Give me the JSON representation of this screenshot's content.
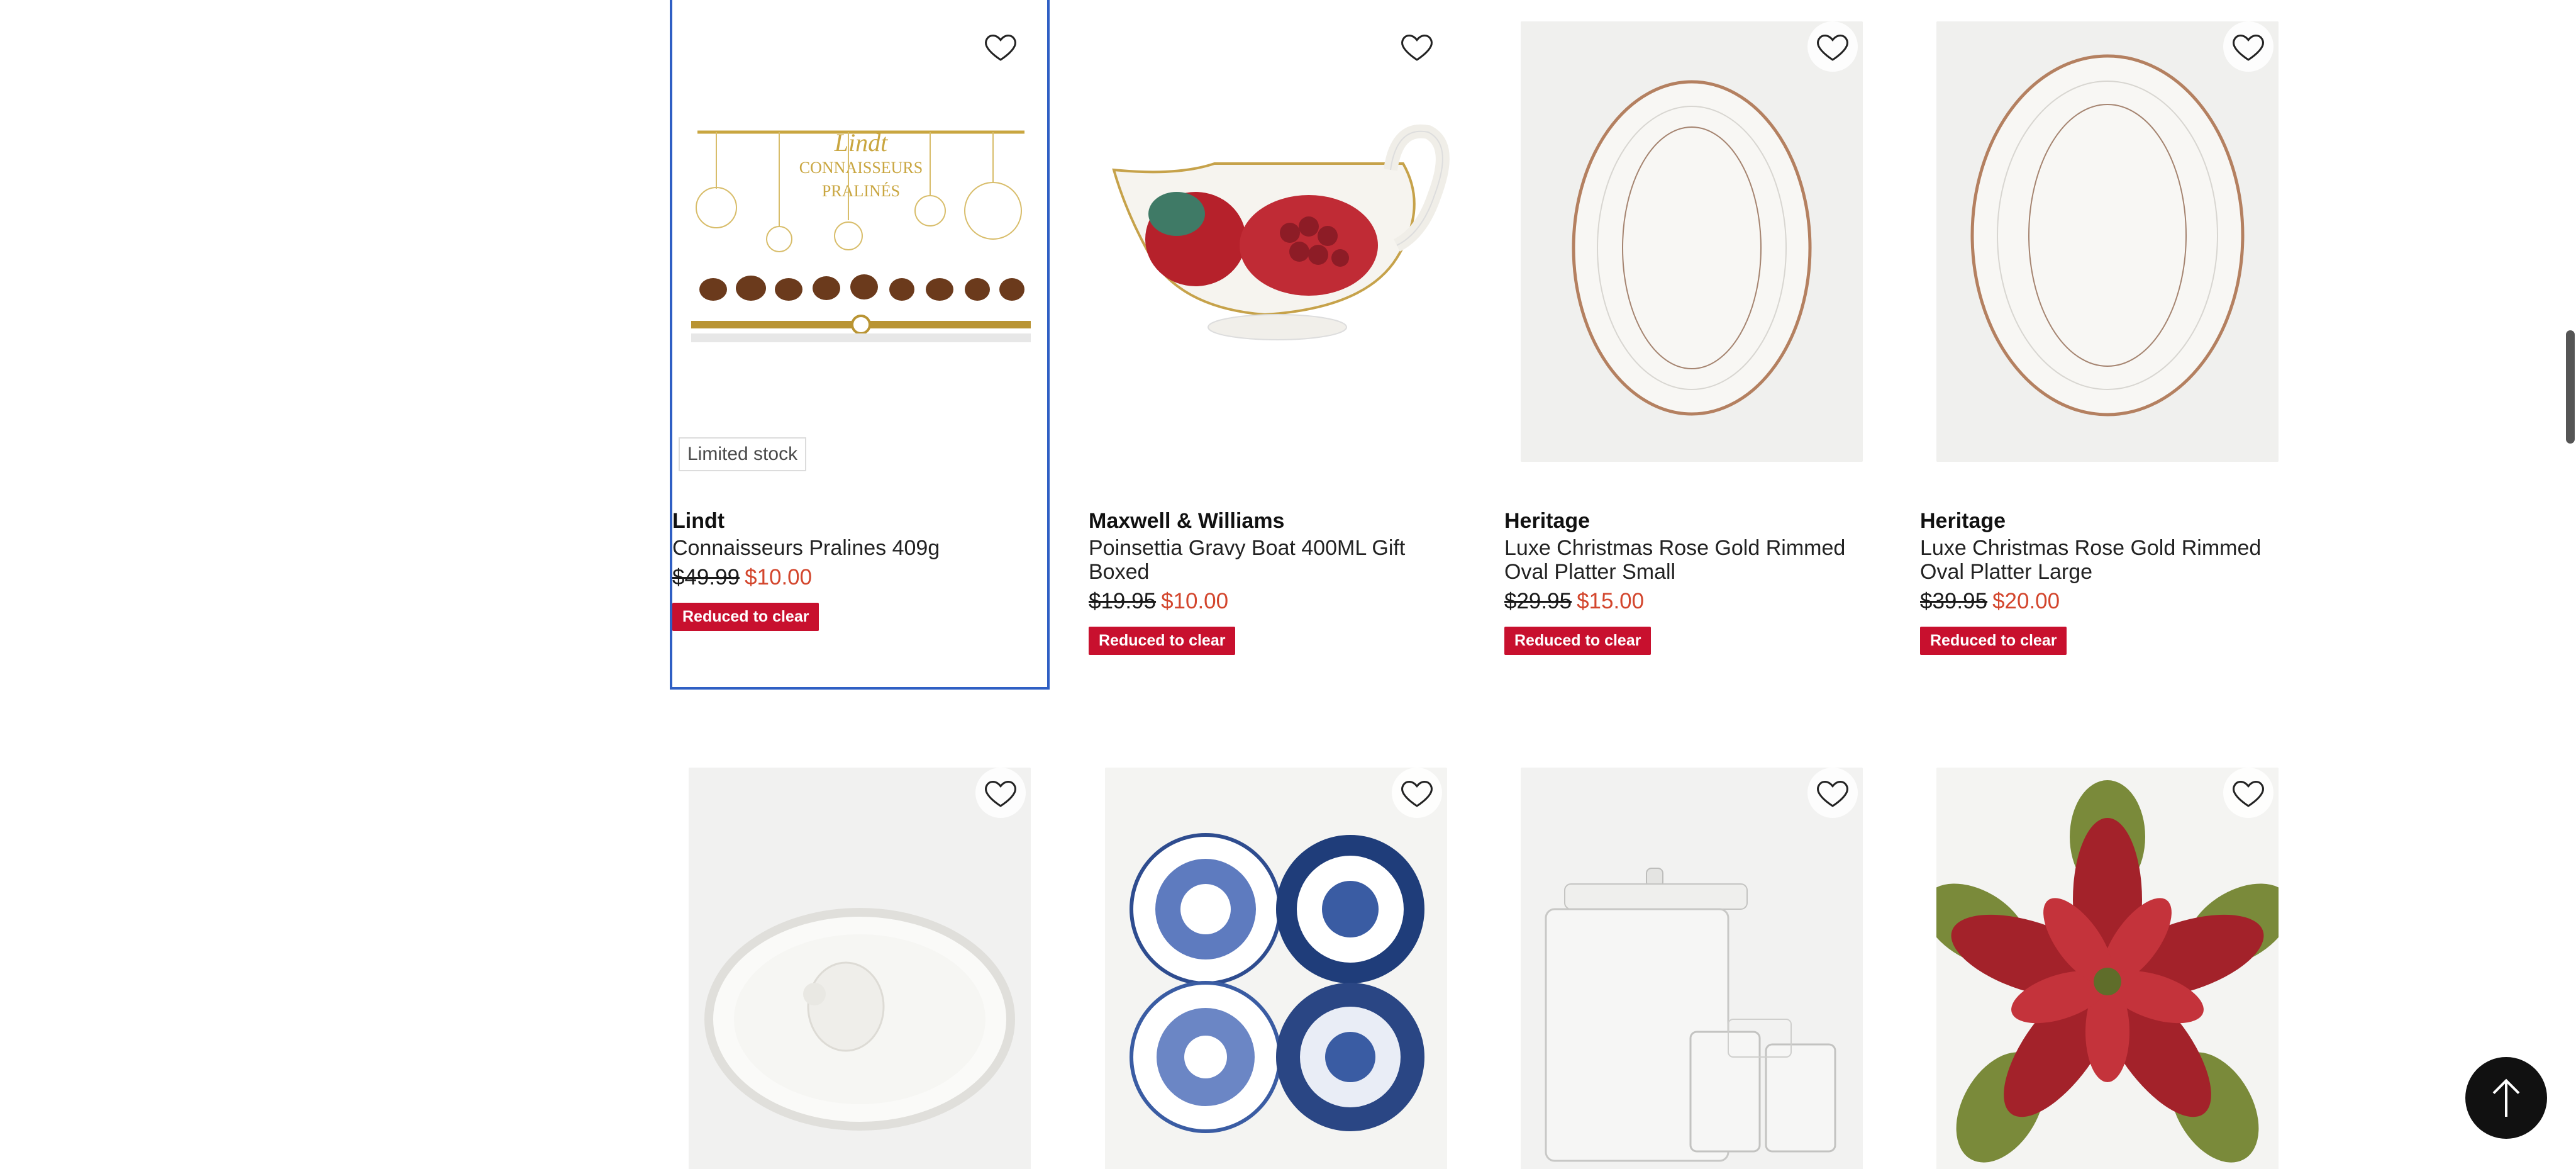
{
  "products": [
    {
      "brand": "Lindt",
      "title": "Connaisseurs Pralines 409g",
      "was_price": "$49.99",
      "now_price": "$10.00",
      "badge": "Reduced to clear",
      "stock_tag": "Limited stock",
      "image": "chocolate-box-image",
      "selected": true
    },
    {
      "brand": "Maxwell & Williams",
      "title": "Poinsettia Gravy Boat 400ML Gift Boxed",
      "was_price": "$19.95",
      "now_price": "$10.00",
      "badge": "Reduced to clear",
      "image": "gravy-boat-image"
    },
    {
      "brand": "Heritage",
      "title": "Luxe Christmas Rose Gold Rimmed Oval Platter Small",
      "was_price": "$29.95",
      "now_price": "$15.00",
      "badge": "Reduced to clear",
      "image": "oval-platter-image"
    },
    {
      "brand": "Heritage",
      "title": "Luxe Christmas Rose Gold Rimmed Oval Platter Large",
      "was_price": "$39.95",
      "now_price": "$20.00",
      "badge": "Reduced to clear",
      "image": "oval-platter-image"
    }
  ],
  "row2": [
    {
      "image": "turkey-platter-image"
    },
    {
      "image": "blue-plates-image"
    },
    {
      "image": "drink-dispenser-image"
    },
    {
      "image": "poinsettia-placemat-image"
    }
  ],
  "icons": {
    "wishlist": "heart-icon",
    "back_to_top": "arrow-up-icon"
  },
  "colors": {
    "sale_price": "#d3462d",
    "badge_bg": "#c8102e",
    "selected_outline": "#2f5fc4"
  }
}
